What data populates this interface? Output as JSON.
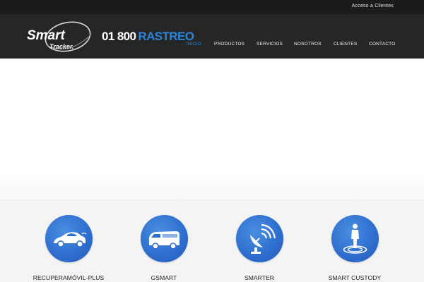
{
  "topbar": {
    "access_link": "Acceso a Clientes"
  },
  "brand": {
    "logo_word": "Smart",
    "logo_sub": "Tracker."
  },
  "phone": {
    "number": "01 800",
    "word": "RASTREO"
  },
  "nav": {
    "items": [
      "INICIO",
      "PRODUCTOS",
      "SERVICIOS",
      "NOSOTROS",
      "CLIENTES",
      "CONTACTO"
    ],
    "active_index": 0
  },
  "products": [
    {
      "label": "RECUPERAMÓVIL-PLUS",
      "icon": "car-icon"
    },
    {
      "label": "GSMART",
      "icon": "van-icon"
    },
    {
      "label": "SMARTER",
      "icon": "satellite-dish-icon"
    },
    {
      "label": "SMART CUSTODY",
      "icon": "person-target-icon"
    }
  ],
  "colors": {
    "accent": "#2f83d6",
    "header": "#262626",
    "topbar": "#1b1b1b",
    "circle": "#2f6fd0"
  }
}
